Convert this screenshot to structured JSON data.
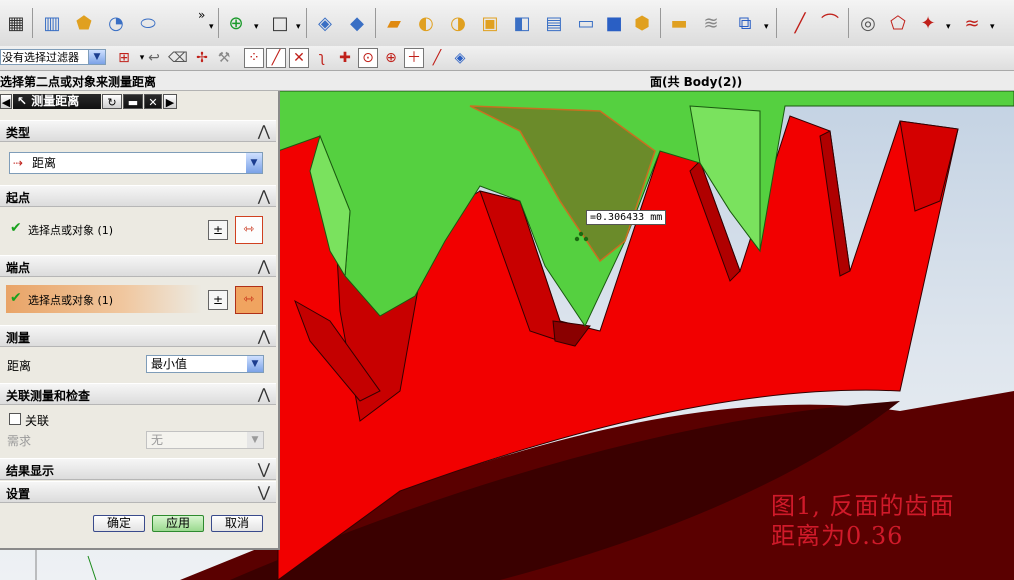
{
  "toolbar": {
    "icons": [
      "part-navigator-icon",
      "book-icon",
      "shield-icon",
      "curve-icon",
      "cylinder-icon",
      "more-icon",
      "sketch-icon",
      "rectangle-icon",
      "box-icon",
      "cube-icon",
      "extrude-icon",
      "revolve-icon",
      "sweep-icon",
      "block-icon",
      "open-book-icon",
      "pipe-icon",
      "blue-cube-icon",
      "bevel-icon",
      "slab-icon",
      "layers-icon",
      "cube-face-icon",
      "line-icon",
      "arc-icon",
      "spiral-icon",
      "shape-icon",
      "node-icon",
      "wave-icon"
    ]
  },
  "selection_bar": {
    "filter_value": "没有选择过滤器"
  },
  "cue_line": {
    "prompt": "选择第二点或对象来测量距离",
    "status": "面(共 Body(2))"
  },
  "dialog": {
    "title": "测量距离",
    "sections": {
      "type": {
        "label": "类型",
        "value": "距离"
      },
      "start_point": {
        "label": "起点",
        "select_label": "选择点或对象 (1)"
      },
      "end_point": {
        "label": "端点",
        "select_label": "选择点或对象 (1)"
      },
      "measure": {
        "label": "测量",
        "distance_label": "距离",
        "distance_value": "最小值"
      },
      "associate": {
        "label": "关联测量和检查",
        "checkbox_label": "关联",
        "requirement_label": "需求",
        "requirement_value": "无"
      },
      "results": {
        "label": "结果显示"
      },
      "settings": {
        "label": "设置"
      }
    },
    "buttons": {
      "ok": "确定",
      "apply": "应用",
      "cancel": "取消"
    }
  },
  "viewport": {
    "measurement": "=0.306433 mm",
    "caption_line1": "图1, 反面的齿面",
    "caption_line2": "距离为0.36",
    "colors": {
      "red_face": "#ff0000",
      "green_face": "#5fd24a",
      "background": "#d4dde8"
    }
  }
}
